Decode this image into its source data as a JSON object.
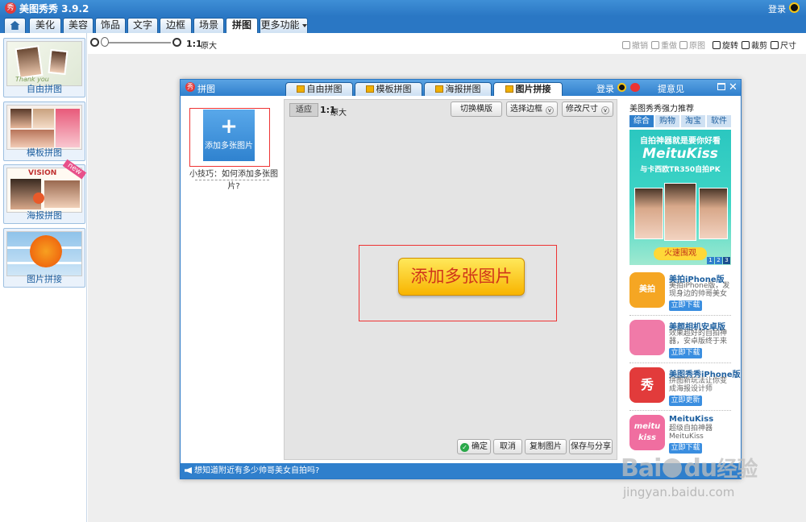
{
  "app": {
    "title": "美图秀秀 3.9.2",
    "logo_glyph": "秀",
    "login": "登录",
    "icons": [
      "qq-icon",
      "folder-icon",
      "home-icon"
    ]
  },
  "tabs": [
    {
      "label": "美化"
    },
    {
      "label": "美容"
    },
    {
      "label": "饰品"
    },
    {
      "label": "文字"
    },
    {
      "label": "边框"
    },
    {
      "label": "场景"
    },
    {
      "label": "拼图",
      "active": true
    },
    {
      "label": "更多功能"
    }
  ],
  "toolbar": {
    "zoom_ratio": "1:1",
    "zoom_actual": "原大",
    "undo": "撤销",
    "redo": "重做",
    "original": "原图",
    "rotate": "旋转",
    "crop": "裁剪",
    "size": "尺寸"
  },
  "left_panel": {
    "items": [
      {
        "label": "自由拼图",
        "thumb_text": "Thank you"
      },
      {
        "label": "模板拼图"
      },
      {
        "label": "海报拼图",
        "thumb_text": "VISION",
        "badge": "new"
      },
      {
        "label": "图片拼接"
      }
    ]
  },
  "dialog": {
    "title": "拼图",
    "logo_glyph": "秀",
    "tabs": [
      {
        "label": "自由拼图"
      },
      {
        "label": "模板拼图"
      },
      {
        "label": "海报拼图"
      },
      {
        "label": "图片拼接",
        "active": true
      }
    ],
    "login": "登录",
    "feedback": "提意见",
    "close_glyph": "✕",
    "add_multi": {
      "glyph": "+",
      "label": "添加多张图片"
    },
    "tip": "小技巧：如何添加多张图片?",
    "canvas": {
      "fit": "适应",
      "ratio": "1:1",
      "actual": "原大",
      "switch_layout": "切换横版",
      "select_border": "选择边框",
      "change_size": "修改尺寸",
      "chevron": "v",
      "big_add": "添加多张图片",
      "confirm": "确定",
      "check_glyph": "✓",
      "cancel": "取消",
      "copy": "复制图片",
      "save_share": "保存与分享"
    },
    "recommend": {
      "title": "美图秀秀强力推荐",
      "tabs": [
        {
          "label": "综合",
          "active": true
        },
        {
          "label": "购物"
        },
        {
          "label": "淘宝"
        },
        {
          "label": "软件"
        }
      ],
      "ad": {
        "tagline": "自拍神器就是要你好看",
        "brand": "MeituKiss",
        "sub": "与卡西欧TR350自拍PK",
        "button": "火速围观",
        "pages": [
          "1",
          "2",
          "3"
        ]
      },
      "apps": [
        {
          "name": "美拍iPhone版",
          "desc": "美拍iPhone版，发现身边的帅哥美女",
          "icon_text": "美拍",
          "button": "立即下载",
          "color": "#f5a623"
        },
        {
          "name": "美颜相机安卓版",
          "desc": "效果超好的自拍神器，安卓版终于来",
          "icon_text": "",
          "button": "立即下载",
          "color": "#f07aa8"
        },
        {
          "name": "美图秀秀iPhone版",
          "desc": "拼图新玩法让你变成海报设计师",
          "icon_text": "秀",
          "button": "立即更新",
          "color": "#e23b3b"
        },
        {
          "name": "MeituKiss",
          "desc": "超级自拍神器 MeituKiss",
          "icon_text": "meitu kiss",
          "button": "立即下载",
          "color": "#f06ea0"
        }
      ]
    },
    "status": "想知道附近有多少帅哥美女自拍吗?"
  },
  "watermark": {
    "logo_left": "Bai",
    "logo_right": "du",
    "logo_cn": "经验",
    "url": "jingyan.baidu.com"
  }
}
